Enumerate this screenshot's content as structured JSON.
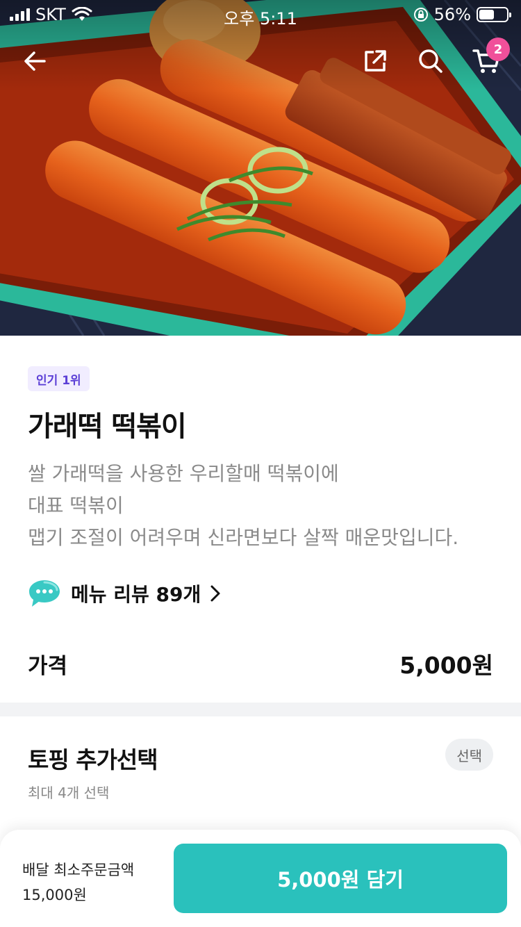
{
  "status_bar": {
    "carrier": "SKT",
    "time": "오후 5:11",
    "battery_percent": "56%",
    "battery_level": 0.56
  },
  "nav": {
    "back_icon": "arrow-left-icon",
    "share_icon": "share-icon",
    "search_icon": "search-icon",
    "cart_icon": "cart-icon",
    "cart_count": "2"
  },
  "menu": {
    "badge": "인기 1위",
    "name": "가래떡 떡볶이",
    "description": [
      "쌀 가래떡을 사용한 우리할매 떡볶이에",
      "대표 떡볶이",
      "맵기 조절이 어려우며 신라면보다 살짝 매운맛입니다."
    ],
    "review_label": "메뉴 리뷰 89개",
    "price_label": "가격",
    "price_value": "5,000원"
  },
  "topping": {
    "title": "토핑 추가선택",
    "subtitle": "최대 4개 선택",
    "chip": "선택"
  },
  "bottom_bar": {
    "min_order_label": "배달 최소주문금액",
    "min_order_value": "15,000원",
    "cta_label": "5,000원 담기"
  },
  "colors": {
    "accent": "#2ac1bc",
    "badge_bg": "#f1edff",
    "badge_text": "#5b3fd6",
    "cart_badge": "#f0509a"
  }
}
